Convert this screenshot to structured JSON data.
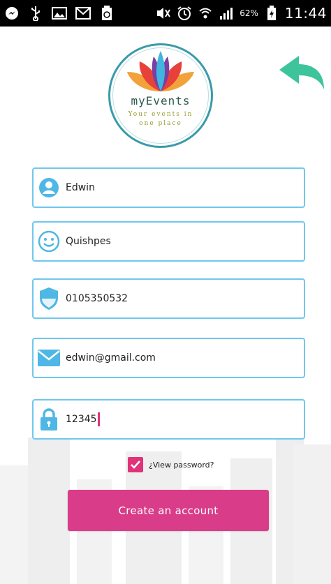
{
  "status_bar": {
    "battery_percent": "62%",
    "time": "11:44"
  },
  "logo": {
    "title": "myEvents",
    "tagline_line1": "Your events in",
    "tagline_line2": "one place"
  },
  "form": {
    "first_name": "Edwin",
    "last_name": "Quishpes",
    "id_number": "0105350532",
    "email": "edwin@gmail.com",
    "password": "12345"
  },
  "view_password": {
    "label": "¿View password?",
    "checked": true
  },
  "create_button": {
    "label": "Create an account"
  },
  "colors": {
    "accent_pink": "#d93c89",
    "field_border": "#6fc7ee",
    "back_arrow": "#3ec49a"
  },
  "icons": {
    "first_name": "user-icon",
    "last_name": "smiley-icon",
    "id_number": "shield-icon",
    "email": "mail-icon",
    "password": "lock-icon",
    "back": "back-arrow-icon"
  }
}
